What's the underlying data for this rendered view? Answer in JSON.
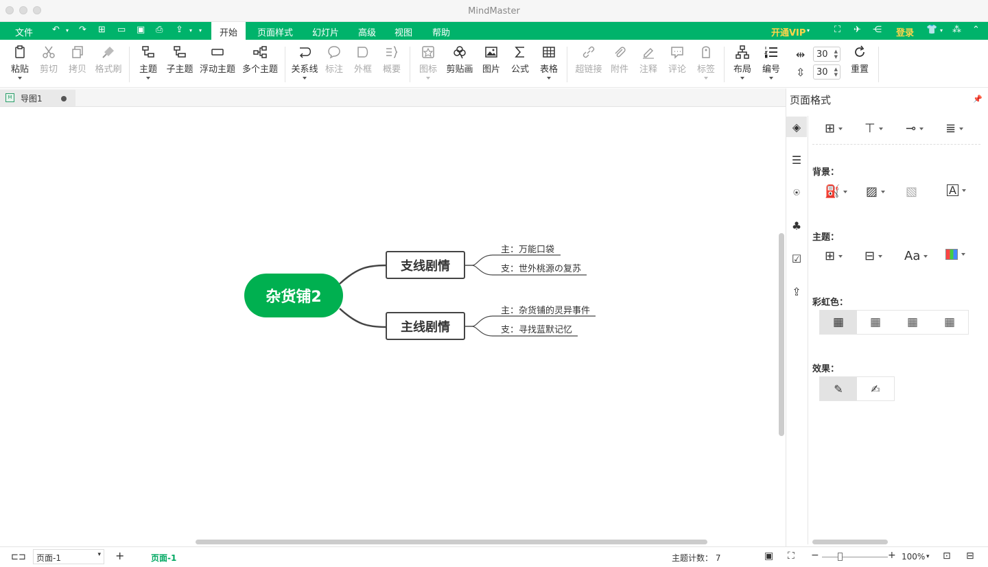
{
  "app": {
    "title": "MindMaster"
  },
  "menubar": {
    "items": [
      "文件",
      "开始",
      "页面样式",
      "幻灯片",
      "高级",
      "视图",
      "帮助"
    ],
    "vip": "开通VIP",
    "login": "登录"
  },
  "toolbar": {
    "paste": "粘贴",
    "cut": "剪切",
    "copy": "拷贝",
    "format_painter": "格式刷",
    "topic": "主题",
    "subtopic": "子主题",
    "floating_topic": "浮动主题",
    "multiple_topics": "多个主题",
    "relationship": "关系线",
    "callout": "标注",
    "boundary": "外框",
    "summary": "概要",
    "icon": "图标",
    "clipart": "剪贴画",
    "picture": "图片",
    "formula": "公式",
    "table": "表格",
    "hyperlink": "超链接",
    "attachment": "附件",
    "note": "注释",
    "comment": "评论",
    "tag": "标签",
    "layout": "布局",
    "numbering": "编号",
    "h_spacing": "30",
    "v_spacing": "30",
    "reset": "重置"
  },
  "doc_tab": {
    "name": "导图1"
  },
  "mindmap": {
    "central": "杂货铺2",
    "branches": [
      {
        "label": "支线剧情",
        "leaves": [
          "主：万能口袋",
          "支：世外桃源の复苏"
        ]
      },
      {
        "label": "主线剧情",
        "leaves": [
          "主：杂货铺的灵异事件",
          "支：寻找蓝默记忆"
        ]
      }
    ],
    "central_color": "#00b050"
  },
  "panel": {
    "title": "页面格式",
    "background_label": "背景：",
    "theme_label": "主题：",
    "rainbow_label": "彩虹色：",
    "effect_label": "效果："
  },
  "statusbar": {
    "page_select": "页面-1",
    "page_tab": "页面-1",
    "topic_count": "主题计数： 7",
    "zoom": "100%"
  },
  "colors": {
    "accent": "#00b36b",
    "vip": "#ffd54a"
  }
}
